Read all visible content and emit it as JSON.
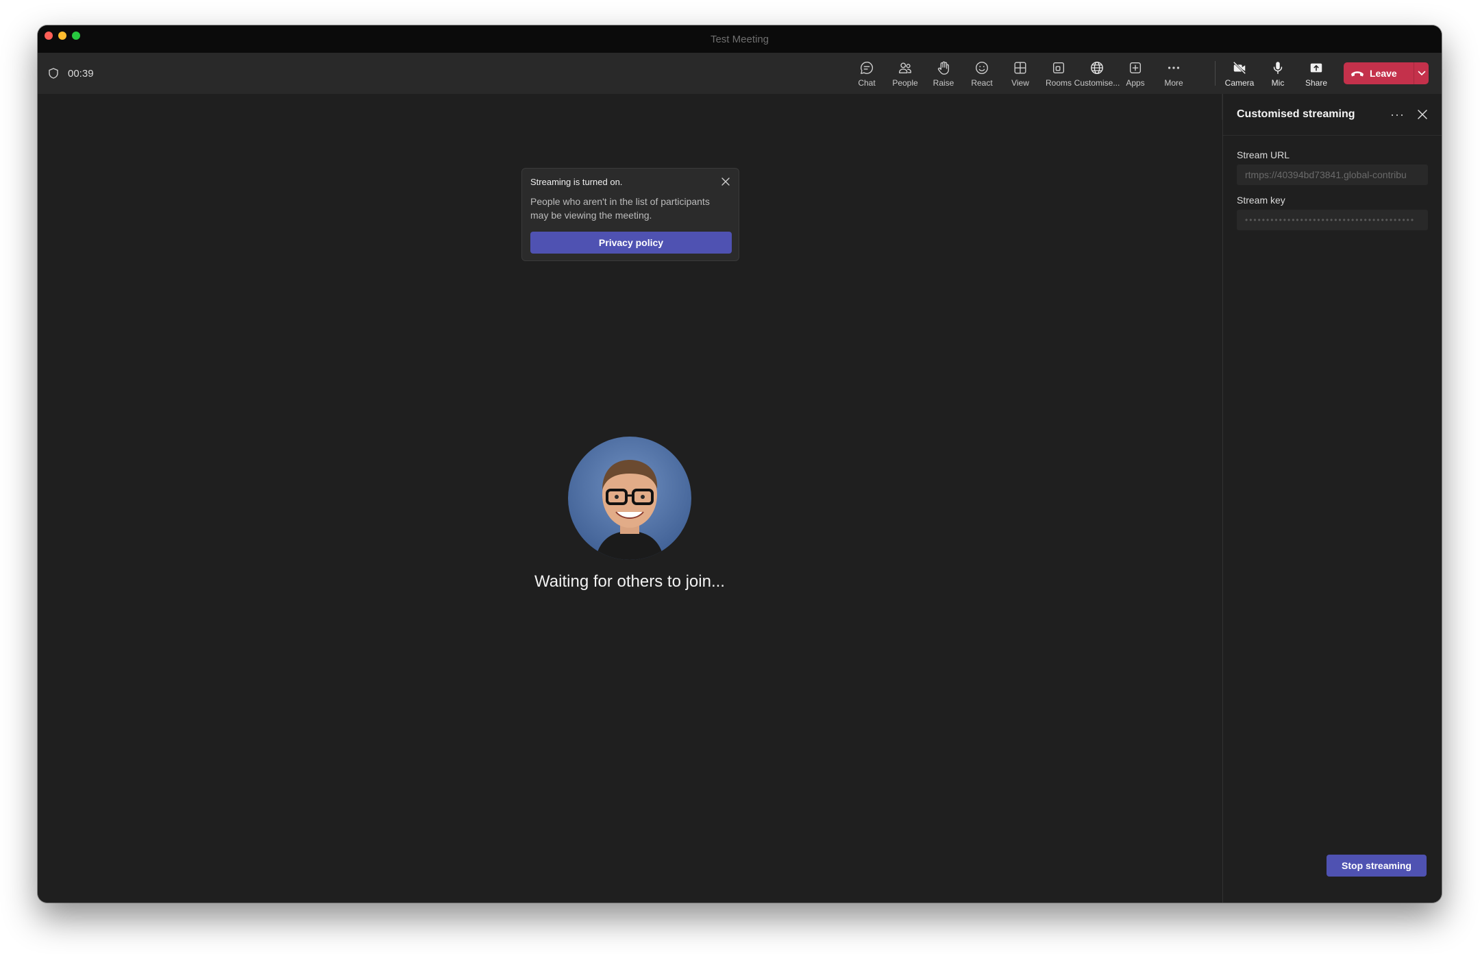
{
  "window": {
    "title": "Test Meeting"
  },
  "toolbar": {
    "timer": "00:39",
    "items": [
      {
        "label": "Chat",
        "icon": "chat-icon"
      },
      {
        "label": "People",
        "icon": "people-icon"
      },
      {
        "label": "Raise",
        "icon": "hand-icon"
      },
      {
        "label": "React",
        "icon": "smiley-icon"
      },
      {
        "label": "View",
        "icon": "grid-icon"
      },
      {
        "label": "Rooms",
        "icon": "rooms-icon"
      },
      {
        "label": "Customise...",
        "icon": "globe-icon"
      },
      {
        "label": "Apps",
        "icon": "apps-icon"
      },
      {
        "label": "More",
        "icon": "more-icon"
      }
    ],
    "camera_label": "Camera",
    "mic_label": "Mic",
    "share_label": "Share",
    "leave_label": "Leave"
  },
  "toast": {
    "title": "Streaming is turned on.",
    "body": "People who aren't in the list of participants may be viewing the meeting.",
    "button": "Privacy policy"
  },
  "stage": {
    "waiting_text": "Waiting for others to join..."
  },
  "panel": {
    "title": "Customised streaming",
    "stream_url_label": "Stream URL",
    "stream_url_value": "rtmps://40394bd73841.global-contribu",
    "stream_key_label": "Stream key",
    "stream_key_value": "••••••••••••••••••••••••••••••••••••••••",
    "stop_button": "Stop streaming"
  },
  "colors": {
    "accent": "#4f52b2",
    "leave": "#c4314b",
    "background": "#1f1f1f"
  }
}
